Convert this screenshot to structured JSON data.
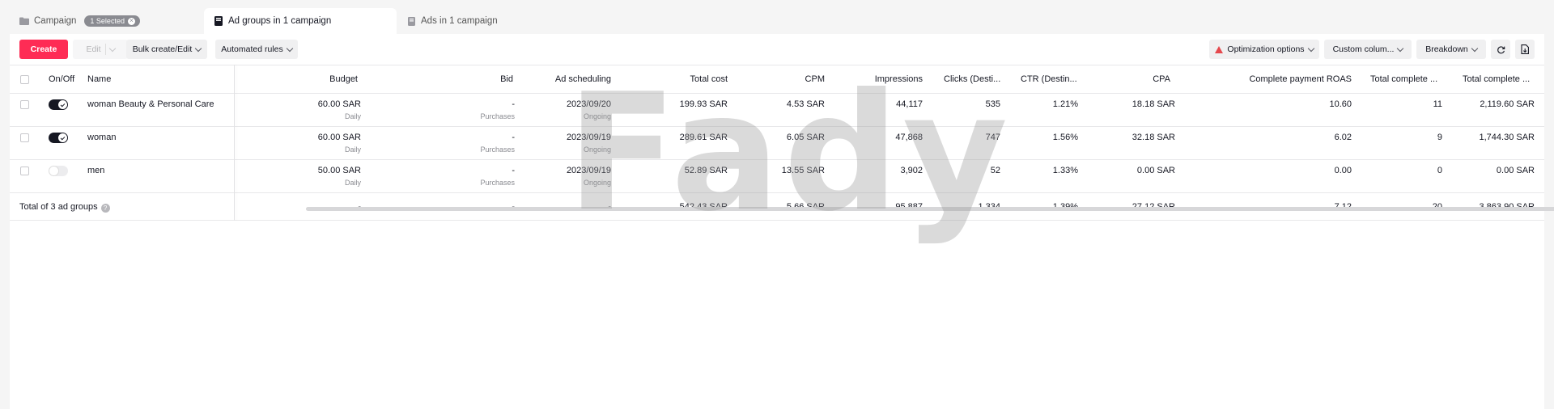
{
  "tabs": [
    {
      "label": "Campaign",
      "badge": "1 Selected",
      "icon": "folder-icon"
    },
    {
      "label": "Ad groups in 1 campaign",
      "icon": "ad-group-icon"
    },
    {
      "label": "Ads in 1 campaign",
      "icon": "ad-icon"
    }
  ],
  "toolbar": {
    "create": "Create",
    "edit": "Edit",
    "bulk": "Bulk create/Edit",
    "automated": "Automated rules",
    "optimization": "Optimization options",
    "custom_columns": "Custom colum...",
    "breakdown": "Breakdown"
  },
  "columns": {
    "onoff": "On/Off",
    "name": "Name",
    "budget": "Budget",
    "bid": "Bid",
    "scheduling": "Ad scheduling",
    "total_cost": "Total cost",
    "cpm": "CPM",
    "impressions": "Impressions",
    "clicks": "Clicks (Desti...",
    "ctr": "CTR (Destin...",
    "cpa": "CPA",
    "roas": "Complete payment ROAS",
    "total_complete_1": "Total complete ...",
    "total_complete_2": "Total complete ..."
  },
  "rows": [
    {
      "name": "woman Beauty & Personal Care",
      "on": true,
      "budget": "60.00 SAR",
      "budget_sub": "Daily",
      "bid": "-",
      "bid_sub": "Purchases",
      "schedule": "2023/09/20",
      "schedule_sub": "Ongoing",
      "total_cost": "199.93 SAR",
      "cpm": "4.53 SAR",
      "impressions": "44,117",
      "clicks": "535",
      "ctr": "1.21%",
      "cpa": "18.18 SAR",
      "roas": "10.60",
      "tc1": "11",
      "tc2": "2,119.60 SAR"
    },
    {
      "name": "woman",
      "on": true,
      "budget": "60.00 SAR",
      "budget_sub": "Daily",
      "bid": "-",
      "bid_sub": "Purchases",
      "schedule": "2023/09/19",
      "schedule_sub": "Ongoing",
      "total_cost": "289.61 SAR",
      "cpm": "6.05 SAR",
      "impressions": "47,868",
      "clicks": "747",
      "ctr": "1.56%",
      "cpa": "32.18 SAR",
      "roas": "6.02",
      "tc1": "9",
      "tc2": "1,744.30 SAR"
    },
    {
      "name": "men",
      "on": false,
      "budget": "50.00 SAR",
      "budget_sub": "Daily",
      "bid": "-",
      "bid_sub": "Purchases",
      "schedule": "2023/09/19",
      "schedule_sub": "Ongoing",
      "total_cost": "52.89 SAR",
      "cpm": "13.55 SAR",
      "impressions": "3,902",
      "clicks": "52",
      "ctr": "1.33%",
      "cpa": "0.00 SAR",
      "roas": "0.00",
      "tc1": "0",
      "tc2": "0.00 SAR"
    }
  ],
  "total": {
    "label": "Total of 3 ad groups",
    "budget": "-",
    "bid": "-",
    "schedule": "-",
    "total_cost": "542.43 SAR",
    "cpm": "5.66 SAR",
    "impressions": "95,887",
    "clicks": "1,334",
    "ctr": "1.39%",
    "cpa": "27.12 SAR",
    "roas": "7.12",
    "tc1": "20",
    "tc2": "3,863.90 SAR"
  },
  "watermark": "Fady",
  "colors": {
    "accent": "#fe2c55",
    "warning": "#e5484d"
  }
}
